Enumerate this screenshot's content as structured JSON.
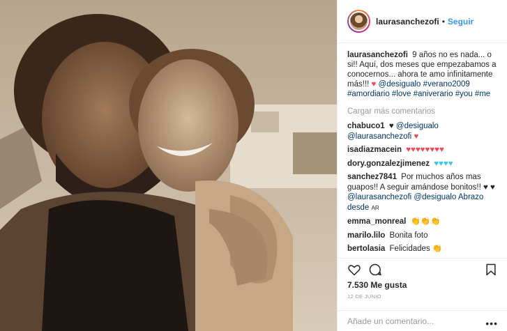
{
  "post": {
    "username": "laurasanchezofi",
    "follow_label": "Seguir",
    "separator": "•"
  },
  "caption": {
    "username": "laurasanchezofi",
    "text": "9 años no es nada... o si!! Aquí, dos meses que empezabamos a conocernos... ahora te amo infinitamente más!!!",
    "mention": "@desigualo",
    "hashtags": "#verano2009 #amordiario #love #aniverario #you #me"
  },
  "load_more_label": "Cargar más comentarios",
  "comments": [
    {
      "user": "chabuco1",
      "prefix": "♥",
      "prefix_color": "black",
      "text": "@desigualo @laurasanchezofi",
      "suffix": "♥",
      "suffix_color": "red"
    },
    {
      "user": "isadiazmacein",
      "text": "",
      "suffix": "♥♥♥♥♥♥♥♥",
      "suffix_color": "red"
    },
    {
      "user": "dory.gonzalezjimenez",
      "text": "",
      "suffix": "♥♥♥♥",
      "suffix_color": "cyan"
    },
    {
      "user": "sanchez7841",
      "text": "Por muchos años mas guapos!! A seguir amándose bonitos!!",
      "prefix": "♥ ♥",
      "prefix_color": "black",
      "tail": "@laurasanchezofi @desigualo Abrazo desde",
      "tag": "AR"
    },
    {
      "user": "emma_monreal",
      "text": "",
      "suffix": "👏👏👏",
      "suffix_color": "clap"
    },
    {
      "user": "marilo.lilo",
      "text": "Bonita foto"
    },
    {
      "user": "bertolasia",
      "text": "Felicidades",
      "suffix": "👏",
      "suffix_color": "black"
    }
  ],
  "likes_label": "7.530 Me gusta",
  "date_label": "12 DE JUNIO",
  "add_comment_placeholder": "Añade un comentario...",
  "more_label": "•••",
  "icons": [
    "heart-icon",
    "comment-icon",
    "bookmark-icon"
  ]
}
